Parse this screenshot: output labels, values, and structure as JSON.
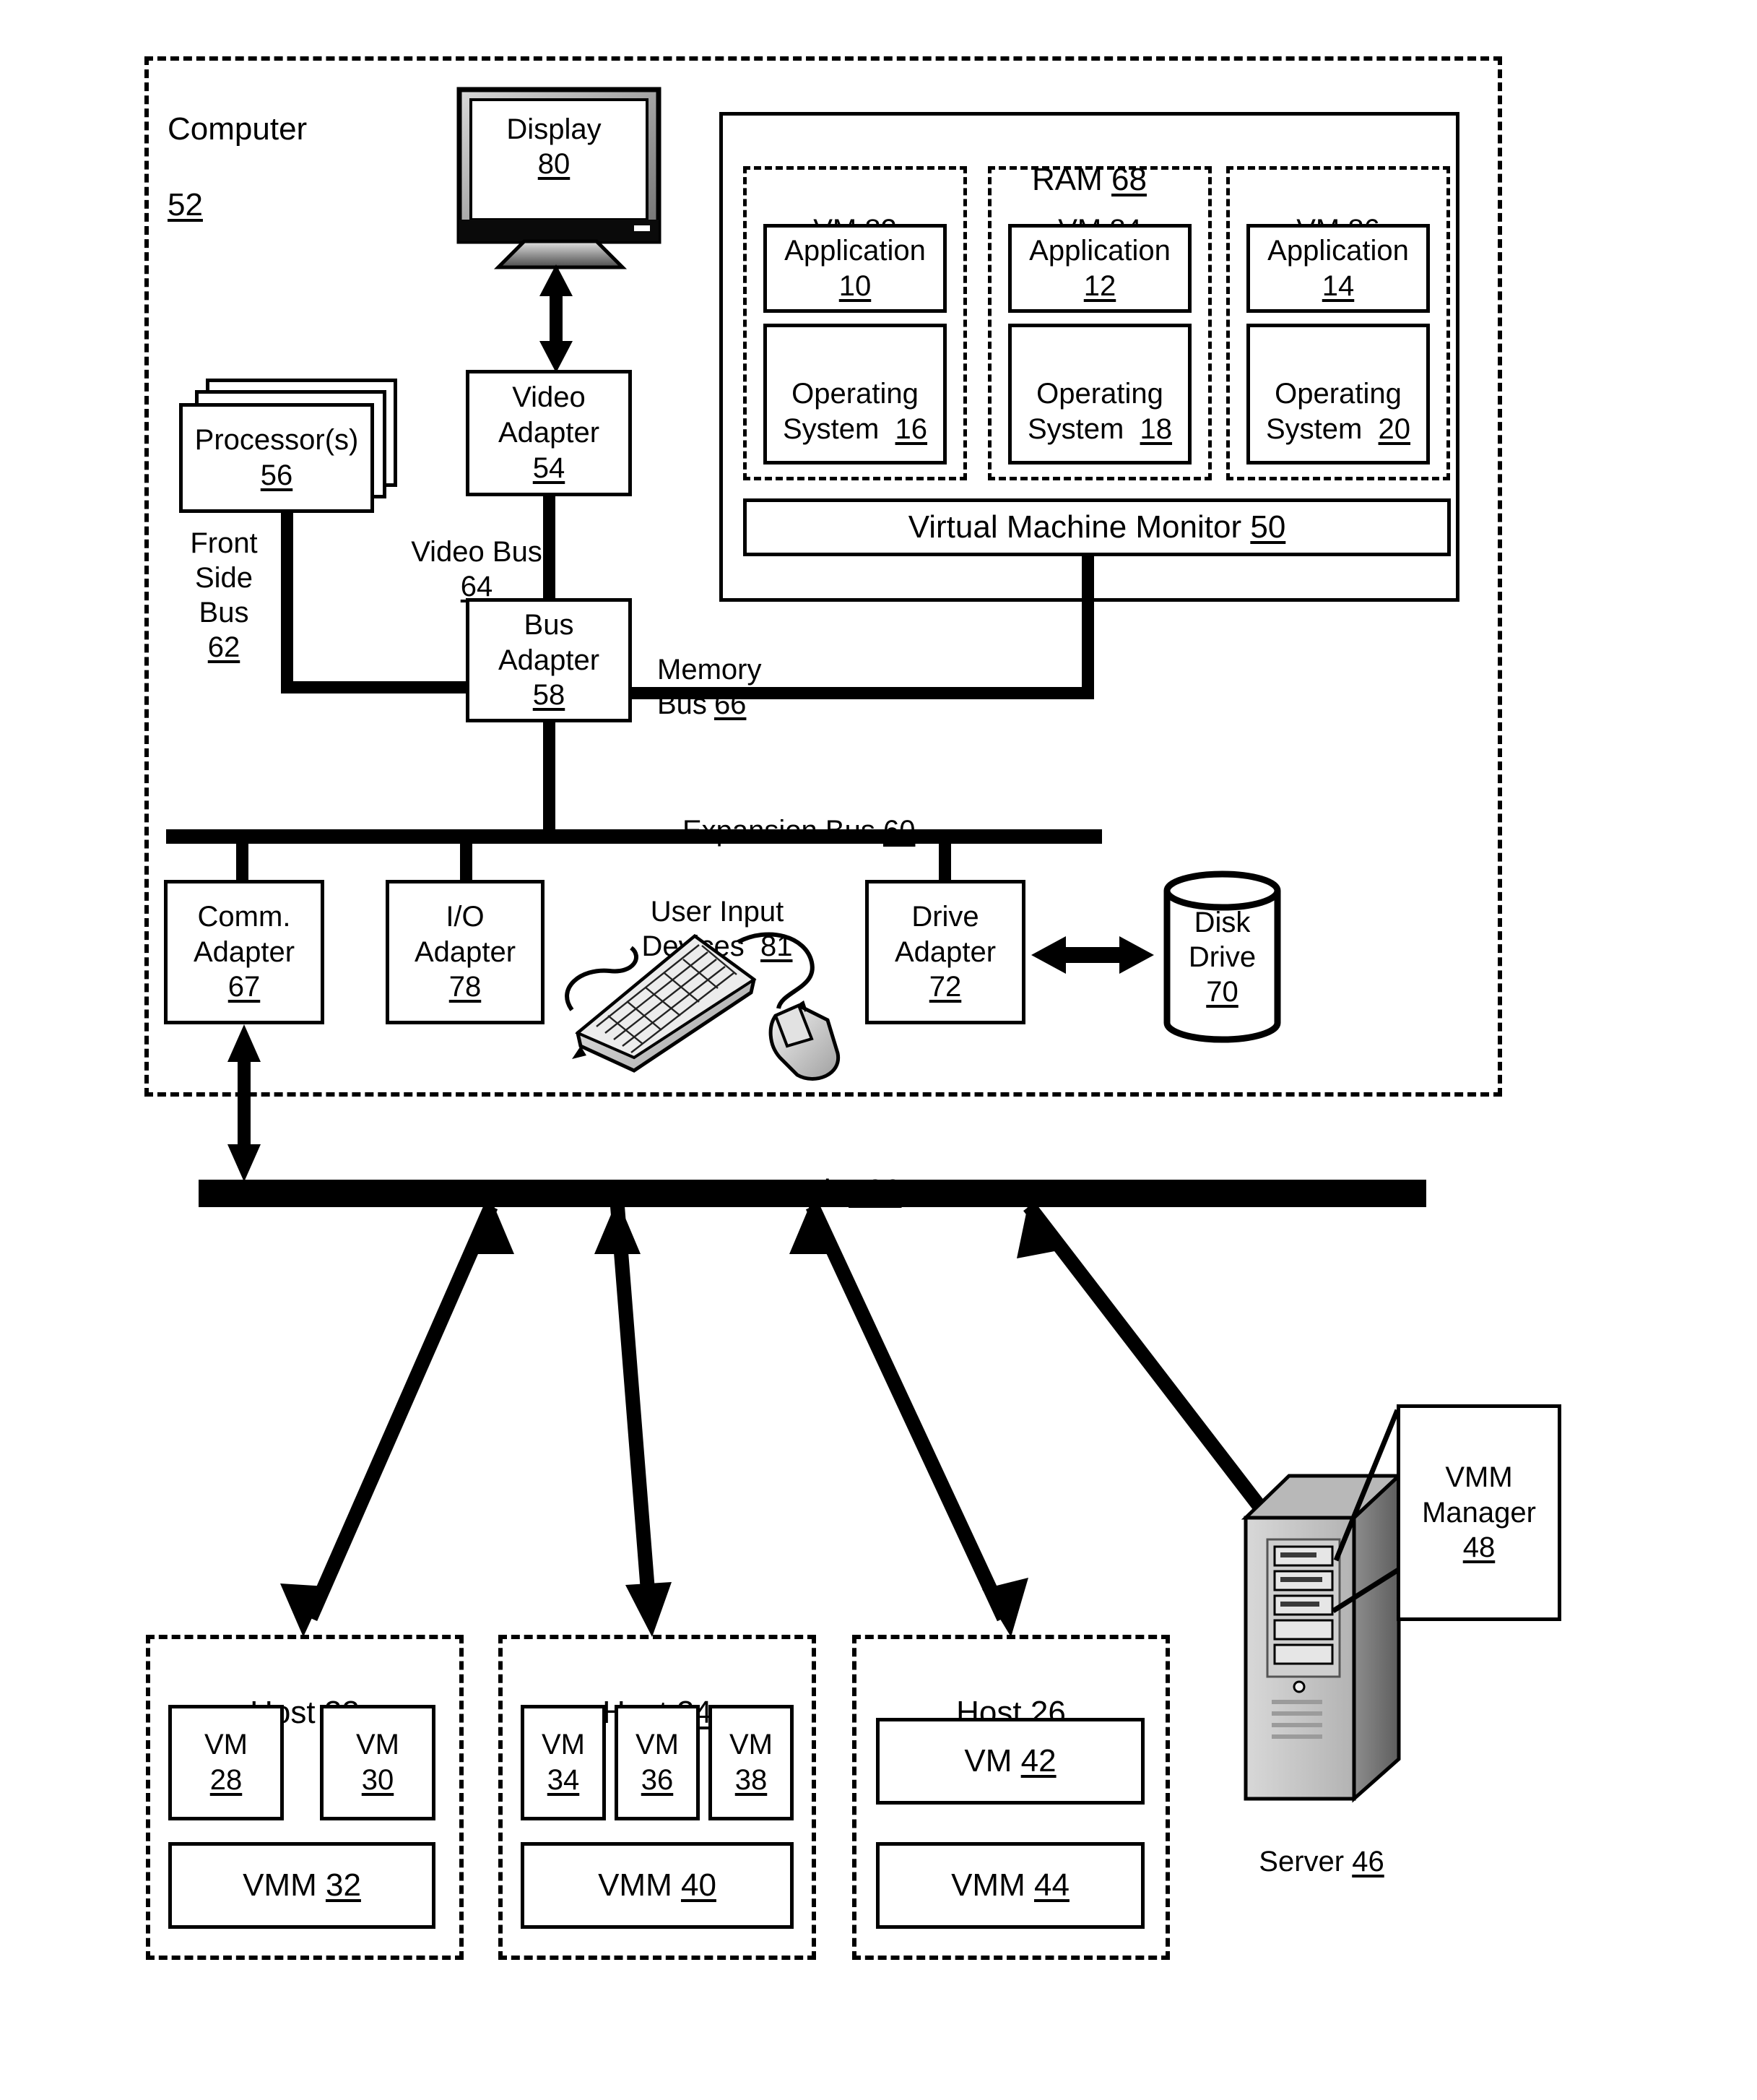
{
  "figure": {
    "computer": {
      "label": "Computer",
      "ref": "52"
    },
    "display": {
      "label": "Display",
      "ref": "80"
    },
    "ram": {
      "label": "RAM",
      "ref": "68"
    },
    "vmm_host": {
      "label": "Virtual Machine Monitor",
      "ref": "50"
    },
    "vms_in_ram": [
      {
        "title": "VM",
        "ref": "82",
        "app": {
          "label": "Application",
          "ref": "10"
        },
        "os": {
          "label": "Operating\nSystem",
          "ref": "16"
        }
      },
      {
        "title": "VM",
        "ref": "84",
        "app": {
          "label": "Application",
          "ref": "12"
        },
        "os": {
          "label": "Operating\nSystem",
          "ref": "18"
        }
      },
      {
        "title": "VM",
        "ref": "86",
        "app": {
          "label": "Application",
          "ref": "14"
        },
        "os": {
          "label": "Operating\nSystem",
          "ref": "20"
        }
      }
    ],
    "processors": {
      "label": "Processor(s)",
      "ref": "56"
    },
    "video_adapter": {
      "label": "Video\nAdapter",
      "ref": "54"
    },
    "bus_adapter": {
      "label": "Bus\nAdapter",
      "ref": "58"
    },
    "buses": {
      "front_side": {
        "label": "Front\nSide\nBus",
        "ref": "62"
      },
      "video": {
        "label": "Video Bus",
        "ref": "64"
      },
      "memory": {
        "label": "Memory\nBus",
        "ref": "66"
      },
      "expansion": {
        "label": "Expansion Bus",
        "ref": "60"
      }
    },
    "comm_adapter": {
      "label": "Comm.\nAdapter",
      "ref": "67"
    },
    "io_adapter": {
      "label": "I/O\nAdapter",
      "ref": "78"
    },
    "user_input": {
      "label": "User Input\nDevices",
      "ref": "81"
    },
    "drive_adapter": {
      "label": "Drive\nAdapter",
      "ref": "72"
    },
    "disk_drive": {
      "label": "Disk\nDrive",
      "ref": "70"
    },
    "network": {
      "label": "Network",
      "ref": "100"
    },
    "hosts": [
      {
        "title": "Host",
        "ref": "22",
        "vms": [
          {
            "label": "VM",
            "ref": "28"
          },
          {
            "label": "VM",
            "ref": "30"
          }
        ],
        "vmm": {
          "label": "VMM",
          "ref": "32"
        }
      },
      {
        "title": "Host",
        "ref": "24",
        "vms": [
          {
            "label": "VM",
            "ref": "34"
          },
          {
            "label": "VM",
            "ref": "36"
          },
          {
            "label": "VM",
            "ref": "38"
          }
        ],
        "vmm": {
          "label": "VMM",
          "ref": "40"
        }
      },
      {
        "title": "Host",
        "ref": "26",
        "vms": [
          {
            "label": "VM",
            "ref": "42"
          }
        ],
        "vmm": {
          "label": "VMM",
          "ref": "44"
        }
      }
    ],
    "server": {
      "label": "Server",
      "ref": "46"
    },
    "vmm_manager": {
      "label": "VMM\nManager",
      "ref": "48"
    },
    "icons": {
      "monitor": "display-monitor-icon",
      "keyboard": "keyboard-icon",
      "mouse": "mouse-icon",
      "server_tower": "server-tower-icon",
      "cylinder": "disk-cylinder-icon"
    },
    "colors": {
      "ink": "#000000",
      "paper": "#ffffff",
      "shade": "#c8c8c8"
    }
  }
}
